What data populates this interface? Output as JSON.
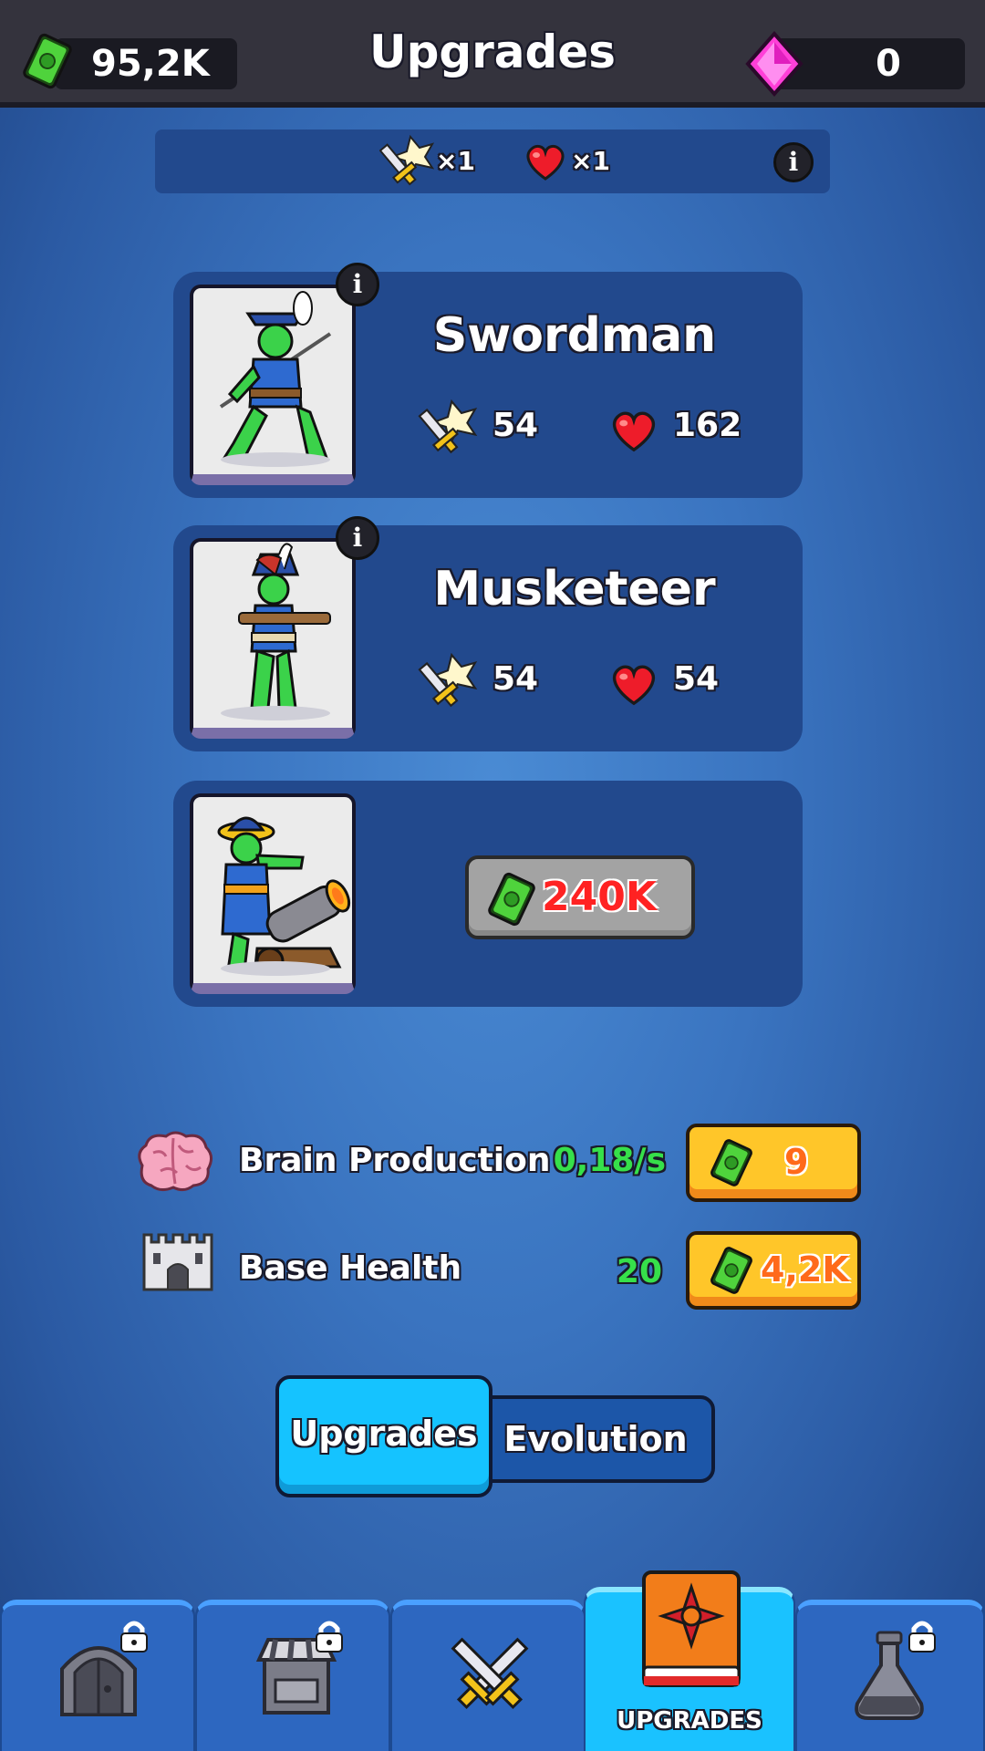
{
  "header": {
    "title": "Upgrades",
    "cash_amount": "95,2K",
    "gem_amount": "0"
  },
  "bonus_bar": {
    "attack_multiplier": "×1",
    "health_multiplier": "×1"
  },
  "units": [
    {
      "name": "Swordman",
      "attack": "54",
      "health": "162",
      "locked": false
    },
    {
      "name": "Musketeer",
      "attack": "54",
      "health": "54",
      "locked": false
    },
    {
      "name": "",
      "locked": true,
      "unlock_price": "240K"
    }
  ],
  "upgrades": [
    {
      "label": "Brain Production",
      "value": "0,18/s",
      "price": "9"
    },
    {
      "label": "Base Health",
      "value": "20",
      "price": "4,2K"
    }
  ],
  "tabs": {
    "upgrades": "Upgrades",
    "evolution": "Evolution",
    "selected": "upgrades"
  },
  "bottom_nav": {
    "items": [
      {
        "icon": "gate-icon",
        "locked": true,
        "label": ""
      },
      {
        "icon": "shop-icon",
        "locked": true,
        "label": ""
      },
      {
        "icon": "crossed-swords-icon",
        "locked": false,
        "label": ""
      },
      {
        "icon": "book-icon",
        "locked": false,
        "label": "UPGRADES",
        "active": true
      },
      {
        "icon": "potion-icon",
        "locked": true,
        "label": ""
      }
    ]
  },
  "colors": {
    "background": "#3a74c0",
    "topbar": "#34333d",
    "card": "#22498d",
    "accent_cyan": "#15c3ff",
    "buy_button": "#ffc629",
    "value_green": "#36e04a",
    "price_red": "#ff2222"
  }
}
